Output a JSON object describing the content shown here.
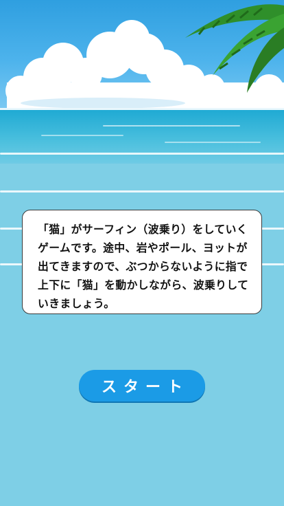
{
  "intro": {
    "description": "「猫」がサーフィン（波乗り）をしていくゲームです。途中、岩やポール、ヨットが出てきますので、ぶつからないように指で上下に「猫」を動かしながら、波乗りしていきましょう。"
  },
  "start_button": {
    "label": "スタート"
  },
  "colors": {
    "button": "#1b9be6",
    "sea": "#7ecfe6",
    "sky": "#2f9fe0"
  },
  "decorations": {
    "clouds": "cumulus-clouds",
    "palm": "palm-leaves-icon"
  }
}
